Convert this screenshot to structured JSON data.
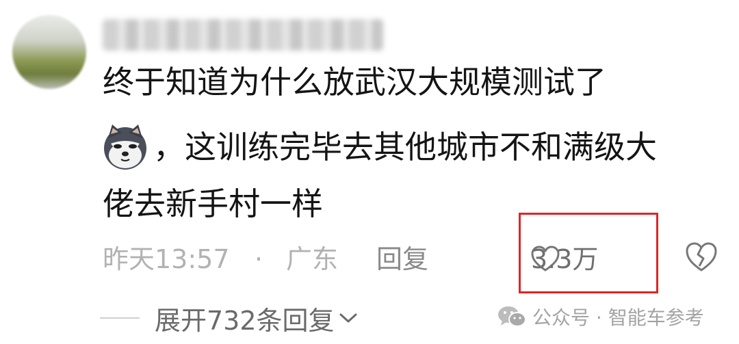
{
  "comment": {
    "line1": "终于知道为什么放武汉大规模测试了",
    "line2": "，这训练完毕去其他城市不和满级大",
    "line3": "佬去新手村一样",
    "emoji_icon": "husky-dog-emoji-icon"
  },
  "meta": {
    "time": "昨天13:57",
    "separator": "·",
    "region": "广东",
    "reply_label": "回复",
    "like_count": "3.3万"
  },
  "expand": {
    "label": "展开732条回复"
  },
  "watermark": {
    "text": "公众号 · 智能车参考"
  },
  "colors": {
    "highlight_border": "#e02424",
    "meta_text": "#b2b2b2",
    "body_text": "#141414"
  }
}
